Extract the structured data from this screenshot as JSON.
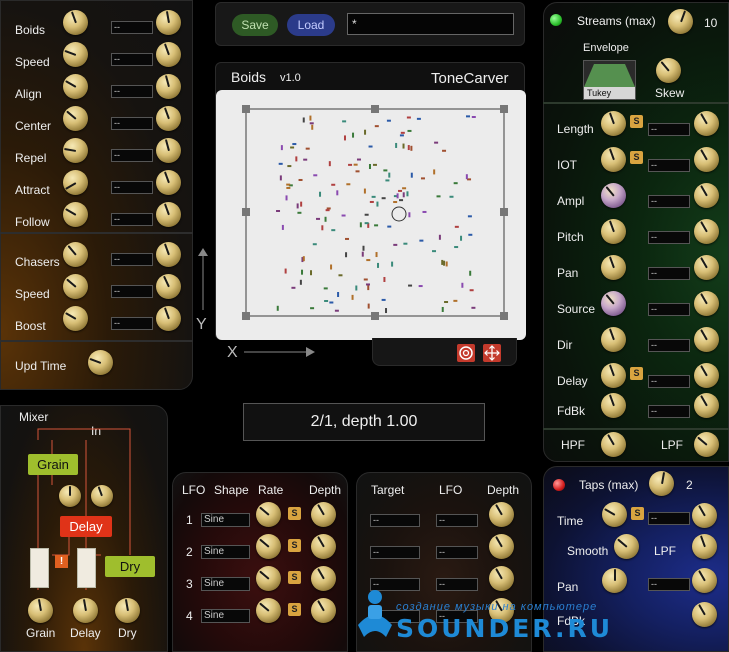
{
  "colors": {
    "accent_save": "#2e5a25",
    "accent_load": "#2b3b8a",
    "delay_red": "#e03318",
    "lime": "#9fbe2d",
    "streams_led": "#2bbf2b",
    "taps_led": "#d21c1c",
    "sbutton": "#d9a440"
  },
  "boids_panel": {
    "rows": [
      {
        "label": "Boids",
        "value": "--"
      },
      {
        "label": "Speed",
        "value": "--"
      },
      {
        "label": "Align",
        "value": "--"
      },
      {
        "label": "Center",
        "value": "--"
      },
      {
        "label": "Repel",
        "value": "--"
      },
      {
        "label": "Attract",
        "value": "--"
      },
      {
        "label": "Follow",
        "value": "--"
      },
      {
        "label": "Chasers",
        "value": "--"
      },
      {
        "label": "Speed",
        "value": "--"
      },
      {
        "label": "Boost",
        "value": "--"
      }
    ],
    "upd_time_label": "Upd Time"
  },
  "toolbar": {
    "save_label": "Save",
    "load_label": "Load",
    "preset_value": "*"
  },
  "display": {
    "title": "Boids",
    "version": "v1.0",
    "brand": "ToneCarver",
    "axis_y": "Y",
    "axis_x": "X",
    "target_icon": "target-icon",
    "move_icon": "move-arrows-icon"
  },
  "ratio_display": "2/1, depth 1.00",
  "streams_panel": {
    "title": "Streams (max)",
    "count": "10",
    "envelope_label": "Envelope",
    "envelope_shape": "Tukey",
    "skew_label": "Skew",
    "rows": [
      {
        "label": "Length",
        "value": "--",
        "s": "S"
      },
      {
        "label": "IOT",
        "value": "--",
        "s": "S"
      },
      {
        "label": "Ampl",
        "value": "--"
      },
      {
        "label": "Pitch",
        "value": "--"
      },
      {
        "label": "Pan",
        "value": "--"
      },
      {
        "label": "Source",
        "value": "--"
      },
      {
        "label": "Dir",
        "value": "--"
      },
      {
        "label": "Delay",
        "value": "--",
        "s": "S"
      },
      {
        "label": "FdBk",
        "value": "--"
      }
    ],
    "hpf_label": "HPF",
    "lpf_label": "LPF"
  },
  "mixer": {
    "title": "Mixer",
    "in_label": "In",
    "grain_tag": "Grain",
    "delay_tag": "Delay",
    "dry_tag": "Dry",
    "warning": "!",
    "bottom": [
      "Grain",
      "Delay",
      "Dry"
    ]
  },
  "lfo_panel": {
    "headers": [
      "LFO",
      "Shape",
      "Rate",
      "Depth"
    ],
    "rows": [
      {
        "n": "1",
        "shape": "Sine",
        "s": "S"
      },
      {
        "n": "2",
        "shape": "Sine",
        "s": "S"
      },
      {
        "n": "3",
        "shape": "Sine",
        "s": "S"
      },
      {
        "n": "4",
        "shape": "Sine",
        "s": "S"
      }
    ]
  },
  "mod_panel": {
    "headers": [
      "Target",
      "LFO",
      "Depth"
    ],
    "rows": [
      {
        "target": "--",
        "lfo": "--"
      },
      {
        "target": "--",
        "lfo": "--"
      },
      {
        "target": "--",
        "lfo": "--"
      },
      {
        "target": "--",
        "lfo": "--"
      }
    ]
  },
  "taps_panel": {
    "title": "Taps (max)",
    "count": "2",
    "time_label": "Time",
    "smooth_label": "Smooth",
    "lpf_label": "LPF",
    "pan_label": "Pan",
    "fdbk_label": "FdBk",
    "time_value": "--",
    "pan_value": "--"
  },
  "watermark": {
    "line1": "создание музыки на компьютере",
    "line2": "SOUNDER.RU"
  }
}
